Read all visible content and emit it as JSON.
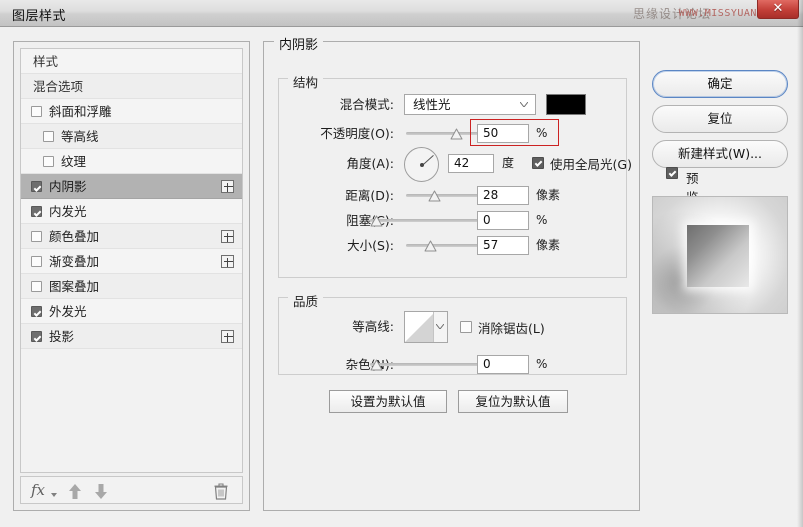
{
  "window": {
    "title": "图层样式",
    "watermark": "思缘设计论坛",
    "watermark_url": "WWW.MISSYUAN.COM",
    "close_glyph": "✕"
  },
  "styles_list": [
    {
      "label": "样式",
      "type": "header",
      "checked": null,
      "indent": 0,
      "plus": false
    },
    {
      "label": "混合选项",
      "type": "header",
      "checked": null,
      "indent": 0,
      "plus": false
    },
    {
      "label": "斜面和浮雕",
      "type": "item",
      "checked": false,
      "indent": 0,
      "plus": false
    },
    {
      "label": "等高线",
      "type": "item",
      "checked": false,
      "indent": 1,
      "plus": false
    },
    {
      "label": "纹理",
      "type": "item",
      "checked": false,
      "indent": 1,
      "plus": false
    },
    {
      "label": "内阴影",
      "type": "item",
      "checked": true,
      "indent": 0,
      "plus": true,
      "selected": true
    },
    {
      "label": "内发光",
      "type": "item",
      "checked": true,
      "indent": 0,
      "plus": false
    },
    {
      "label": "颜色叠加",
      "type": "item",
      "checked": false,
      "indent": 0,
      "plus": true
    },
    {
      "label": "渐变叠加",
      "type": "item",
      "checked": false,
      "indent": 0,
      "plus": true
    },
    {
      "label": "图案叠加",
      "type": "item",
      "checked": false,
      "indent": 0,
      "plus": false
    },
    {
      "label": "外发光",
      "type": "item",
      "checked": true,
      "indent": 0,
      "plus": false
    },
    {
      "label": "投影",
      "type": "item",
      "checked": true,
      "indent": 0,
      "plus": true
    }
  ],
  "list_toolbar": {
    "fx_label": "fx",
    "fx_icon": "fx-icon",
    "up_icon": "arrow-up-icon",
    "down_icon": "arrow-down-icon",
    "trash_icon": "trash-icon"
  },
  "main": {
    "section_title": "内阴影",
    "structure": {
      "title": "结构",
      "blend_mode": {
        "label": "混合模式:",
        "value": "线性光",
        "color": "#000000"
      },
      "opacity": {
        "label": "不透明度(O):",
        "value": "50",
        "unit": "%",
        "highlighted": true
      },
      "angle": {
        "label": "角度(A):",
        "value": "42",
        "unit": "度",
        "global_light_label": "使用全局光(G)",
        "global_light_checked": true,
        "degrees": 42
      },
      "distance": {
        "label": "距离(D):",
        "value": "28",
        "unit": "像素",
        "fill": 0.28
      },
      "choke": {
        "label": "阻塞(C):",
        "value": "0",
        "unit": "%",
        "fill": 0.0
      },
      "size": {
        "label": "大小(S):",
        "value": "57",
        "unit": "像素",
        "fill": 0.23
      }
    },
    "quality": {
      "title": "品质",
      "contour": {
        "label": "等高线:",
        "icon": "contour-preview-icon"
      },
      "antialias": {
        "label": "消除锯齿(L)",
        "checked": false
      },
      "noise": {
        "label": "杂色(N):",
        "value": "0",
        "unit": "%",
        "fill": 0.0
      }
    },
    "buttons": {
      "set_default": "设置为默认值",
      "reset_default": "复位为默认值"
    }
  },
  "right": {
    "ok": "确定",
    "reset": "复位",
    "new_style": "新建样式(W)...",
    "preview": {
      "label": "预览(V)",
      "checked": true
    }
  },
  "colors": {
    "accent_red": "#cc2222",
    "primary_border": "#5b86c4",
    "selection": "#b2b2b2",
    "swatch": "#000000"
  }
}
